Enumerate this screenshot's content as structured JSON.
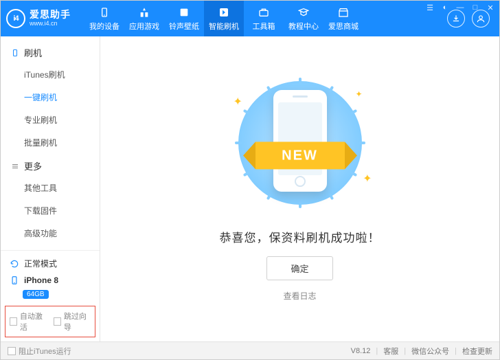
{
  "brand": {
    "logo_text": "i4",
    "name": "爱思助手",
    "url": "www.i4.cn"
  },
  "nav": {
    "items": [
      {
        "label": "我的设备"
      },
      {
        "label": "应用游戏"
      },
      {
        "label": "铃声壁纸"
      },
      {
        "label": "智能刷机"
      },
      {
        "label": "工具箱"
      },
      {
        "label": "教程中心"
      },
      {
        "label": "爱思商城"
      }
    ],
    "active_index": 3
  },
  "sidebar": {
    "categories": [
      {
        "title": "刷机",
        "items": [
          "iTunes刷机",
          "一键刷机",
          "专业刷机",
          "批量刷机"
        ],
        "active_index": 1
      },
      {
        "title": "更多",
        "items": [
          "其他工具",
          "下载固件",
          "高级功能"
        ],
        "active_index": -1
      }
    ],
    "mode_label": "正常模式",
    "device_name": "iPhone 8",
    "device_storage": "64GB",
    "checkboxes": {
      "auto_activate": "自动激活",
      "skip_wizard": "跳过向导"
    }
  },
  "main": {
    "ribbon_text": "NEW",
    "success_text": "恭喜您，保资料刷机成功啦！",
    "confirm_label": "确定",
    "view_log_label": "查看日志"
  },
  "statusbar": {
    "block_itunes": "阻止iTunes运行",
    "version": "V8.12",
    "support": "客服",
    "wechat": "微信公众号",
    "check_update": "检查更新"
  }
}
